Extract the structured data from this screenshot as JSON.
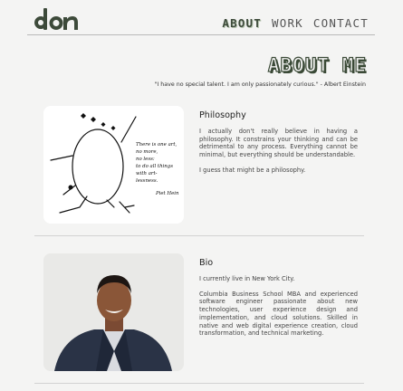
{
  "header": {
    "logo_text": "don",
    "nav": [
      {
        "label": "ABOUT",
        "active": true
      },
      {
        "label": "WORK",
        "active": false
      },
      {
        "label": "CONTACT",
        "active": false
      }
    ]
  },
  "page": {
    "title": "ABOUT ME",
    "quote": "\"I have no special talent. I am only passionately curious.\" - Albert Einstein"
  },
  "philosophy": {
    "heading": "Philosophy",
    "paragraphs": [
      "I actually don't really believe in having a philosophy. It constrains your thinking and can be detrimental to any process. Everything cannot be minimal, but everything should be understandable.",
      "I guess that might be a philosophy."
    ],
    "sketch_caption": [
      "There is one art,",
      "no more,",
      "no less:",
      "to do all things",
      "with art-",
      "lessness."
    ],
    "sketch_signature": "Piet Hein"
  },
  "bio": {
    "heading": "Bio",
    "paragraphs": [
      "I currently live in New York City.",
      "Columbia Business School MBA and experienced software engineer passionate about new technologies, user experience design and implementation, and cloud solutions. Skilled in native and web digital experience creation, cloud transformation, and technical marketing."
    ]
  },
  "colors": {
    "accent": "#3b4a37",
    "background": "#f4f4f3"
  }
}
